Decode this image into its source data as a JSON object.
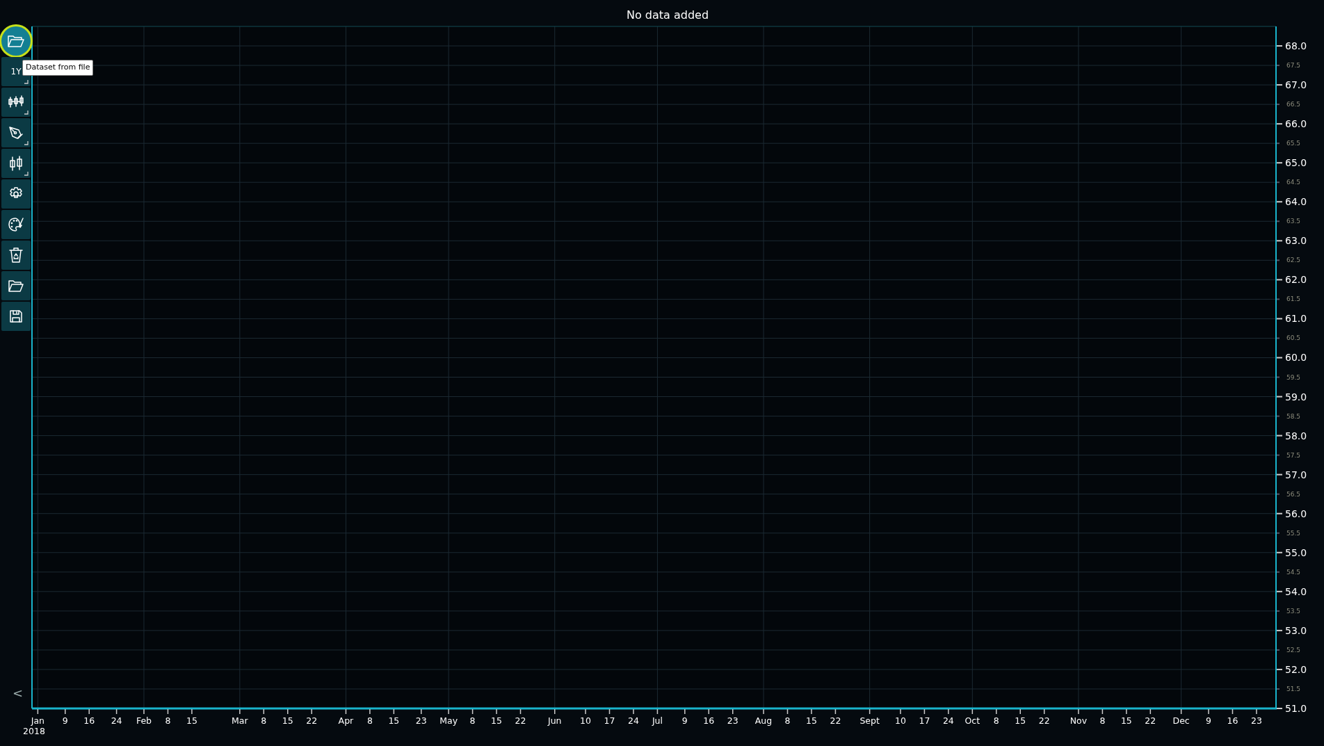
{
  "toolbar": [
    {
      "highlighted": true,
      "submenu": false
    },
    {
      "label": "1Y",
      "highlighted": false,
      "submenu": true
    },
    {
      "highlighted": false,
      "submenu": true
    },
    {
      "highlighted": false,
      "submenu": true
    },
    {
      "highlighted": false,
      "submenu": true
    },
    {
      "highlighted": false,
      "submenu": false
    },
    {
      "highlighted": false,
      "submenu": false
    },
    {
      "highlighted": false,
      "submenu": false
    },
    {
      "highlighted": false,
      "submenu": false
    },
    {
      "highlighted": false,
      "submenu": false
    }
  ],
  "tooltip": {
    "text": "Dataset from file"
  },
  "collapse": {
    "label": "<"
  },
  "chart": {
    "year_label": "2018",
    "minor_y_labels": [
      "67.5",
      "66.5",
      "65.5",
      "64.5",
      "63.5",
      "62.5",
      "61.5",
      "60.5",
      "59.5",
      "58.5",
      "57.5",
      "56.5",
      "55.5",
      "54.5",
      "53.5",
      "52.5",
      "51.5"
    ],
    "chart_data": {
      "type": "line",
      "title": "No data added",
      "grid": true,
      "ylim": [
        51,
        68.5
      ],
      "categories": [
        "Jan",
        null,
        null,
        null,
        null,
        null,
        null,
        null,
        "9",
        null,
        null,
        null,
        null,
        null,
        null,
        "16",
        null,
        null,
        null,
        null,
        null,
        null,
        null,
        "24",
        null,
        null,
        null,
        null,
        null,
        null,
        null,
        "Feb",
        null,
        null,
        null,
        null,
        null,
        null,
        "8",
        null,
        null,
        null,
        null,
        null,
        null,
        "15",
        null,
        null,
        null,
        null,
        null,
        null,
        null,
        null,
        null,
        null,
        null,
        null,
        null,
        "Mar",
        null,
        null,
        null,
        null,
        null,
        null,
        "8",
        null,
        null,
        null,
        null,
        null,
        null,
        "15",
        null,
        null,
        null,
        null,
        null,
        null,
        "22",
        null,
        null,
        null,
        null,
        null,
        null,
        null,
        null,
        null,
        "Apr",
        null,
        null,
        null,
        null,
        null,
        null,
        "8",
        null,
        null,
        null,
        null,
        null,
        null,
        "15",
        null,
        null,
        null,
        null,
        null,
        null,
        null,
        "23",
        null,
        null,
        null,
        null,
        null,
        null,
        null,
        "May",
        null,
        null,
        null,
        null,
        null,
        null,
        "8",
        null,
        null,
        null,
        null,
        null,
        null,
        "15",
        null,
        null,
        null,
        null,
        null,
        null,
        "22",
        null,
        null,
        null,
        null,
        null,
        null,
        null,
        null,
        null,
        "Jun",
        null,
        null,
        null,
        null,
        null,
        null,
        null,
        null,
        "10",
        null,
        null,
        null,
        null,
        null,
        null,
        "17",
        null,
        null,
        null,
        null,
        null,
        null,
        "24",
        null,
        null,
        null,
        null,
        null,
        null,
        "Jul",
        null,
        null,
        null,
        null,
        null,
        null,
        null,
        "9",
        null,
        null,
        null,
        null,
        null,
        null,
        "16",
        null,
        null,
        null,
        null,
        null,
        null,
        "23",
        null,
        null,
        null,
        null,
        null,
        null,
        null,
        null,
        "Aug",
        null,
        null,
        null,
        null,
        null,
        null,
        "8",
        null,
        null,
        null,
        null,
        null,
        null,
        "15",
        null,
        null,
        null,
        null,
        null,
        null,
        "22",
        null,
        null,
        null,
        null,
        null,
        null,
        null,
        null,
        null,
        "Sept",
        null,
        null,
        null,
        null,
        null,
        null,
        null,
        null,
        "10",
        null,
        null,
        null,
        null,
        null,
        null,
        "17",
        null,
        null,
        null,
        null,
        null,
        null,
        "24",
        null,
        null,
        null,
        null,
        null,
        null,
        "Oct",
        null,
        null,
        null,
        null,
        null,
        null,
        "8",
        null,
        null,
        null,
        null,
        null,
        null,
        "15",
        null,
        null,
        null,
        null,
        null,
        null,
        "22",
        null,
        null,
        null,
        null,
        null,
        null,
        null,
        null,
        null,
        "Nov",
        null,
        null,
        null,
        null,
        null,
        null,
        "8",
        null,
        null,
        null,
        null,
        null,
        null,
        "15",
        null,
        null,
        null,
        null,
        null,
        null,
        "22",
        null,
        null,
        null,
        null,
        null,
        null,
        null,
        null,
        "Dec",
        null,
        null,
        null,
        null,
        null,
        null,
        null,
        "9",
        null,
        null,
        null,
        null,
        null,
        null,
        "16",
        null,
        null,
        null,
        null,
        null,
        null,
        "23"
      ],
      "yticks": [
        {
          "value": 51,
          "label": "51.0"
        },
        {
          "value": 52,
          "label": "52.0"
        },
        {
          "value": 53,
          "label": "53.0"
        },
        {
          "value": 54,
          "label": "54.0"
        },
        {
          "value": 55,
          "label": "55.0"
        },
        {
          "value": 56,
          "label": "56.0"
        },
        {
          "value": 57,
          "label": "57.0"
        },
        {
          "value": 58,
          "label": "58.0"
        },
        {
          "value": 59,
          "label": "59.0"
        },
        {
          "value": 60,
          "label": "60.0"
        },
        {
          "value": 61,
          "label": "61.0"
        },
        {
          "value": 62,
          "label": "62.0"
        },
        {
          "value": 63,
          "label": "63.0"
        },
        {
          "value": 64,
          "label": "64.0"
        },
        {
          "value": 65,
          "label": "65.0"
        },
        {
          "value": 66,
          "label": "66.0"
        },
        {
          "value": 67,
          "label": "67.0"
        },
        {
          "value": 68,
          "label": "68.0"
        }
      ]
    }
  }
}
